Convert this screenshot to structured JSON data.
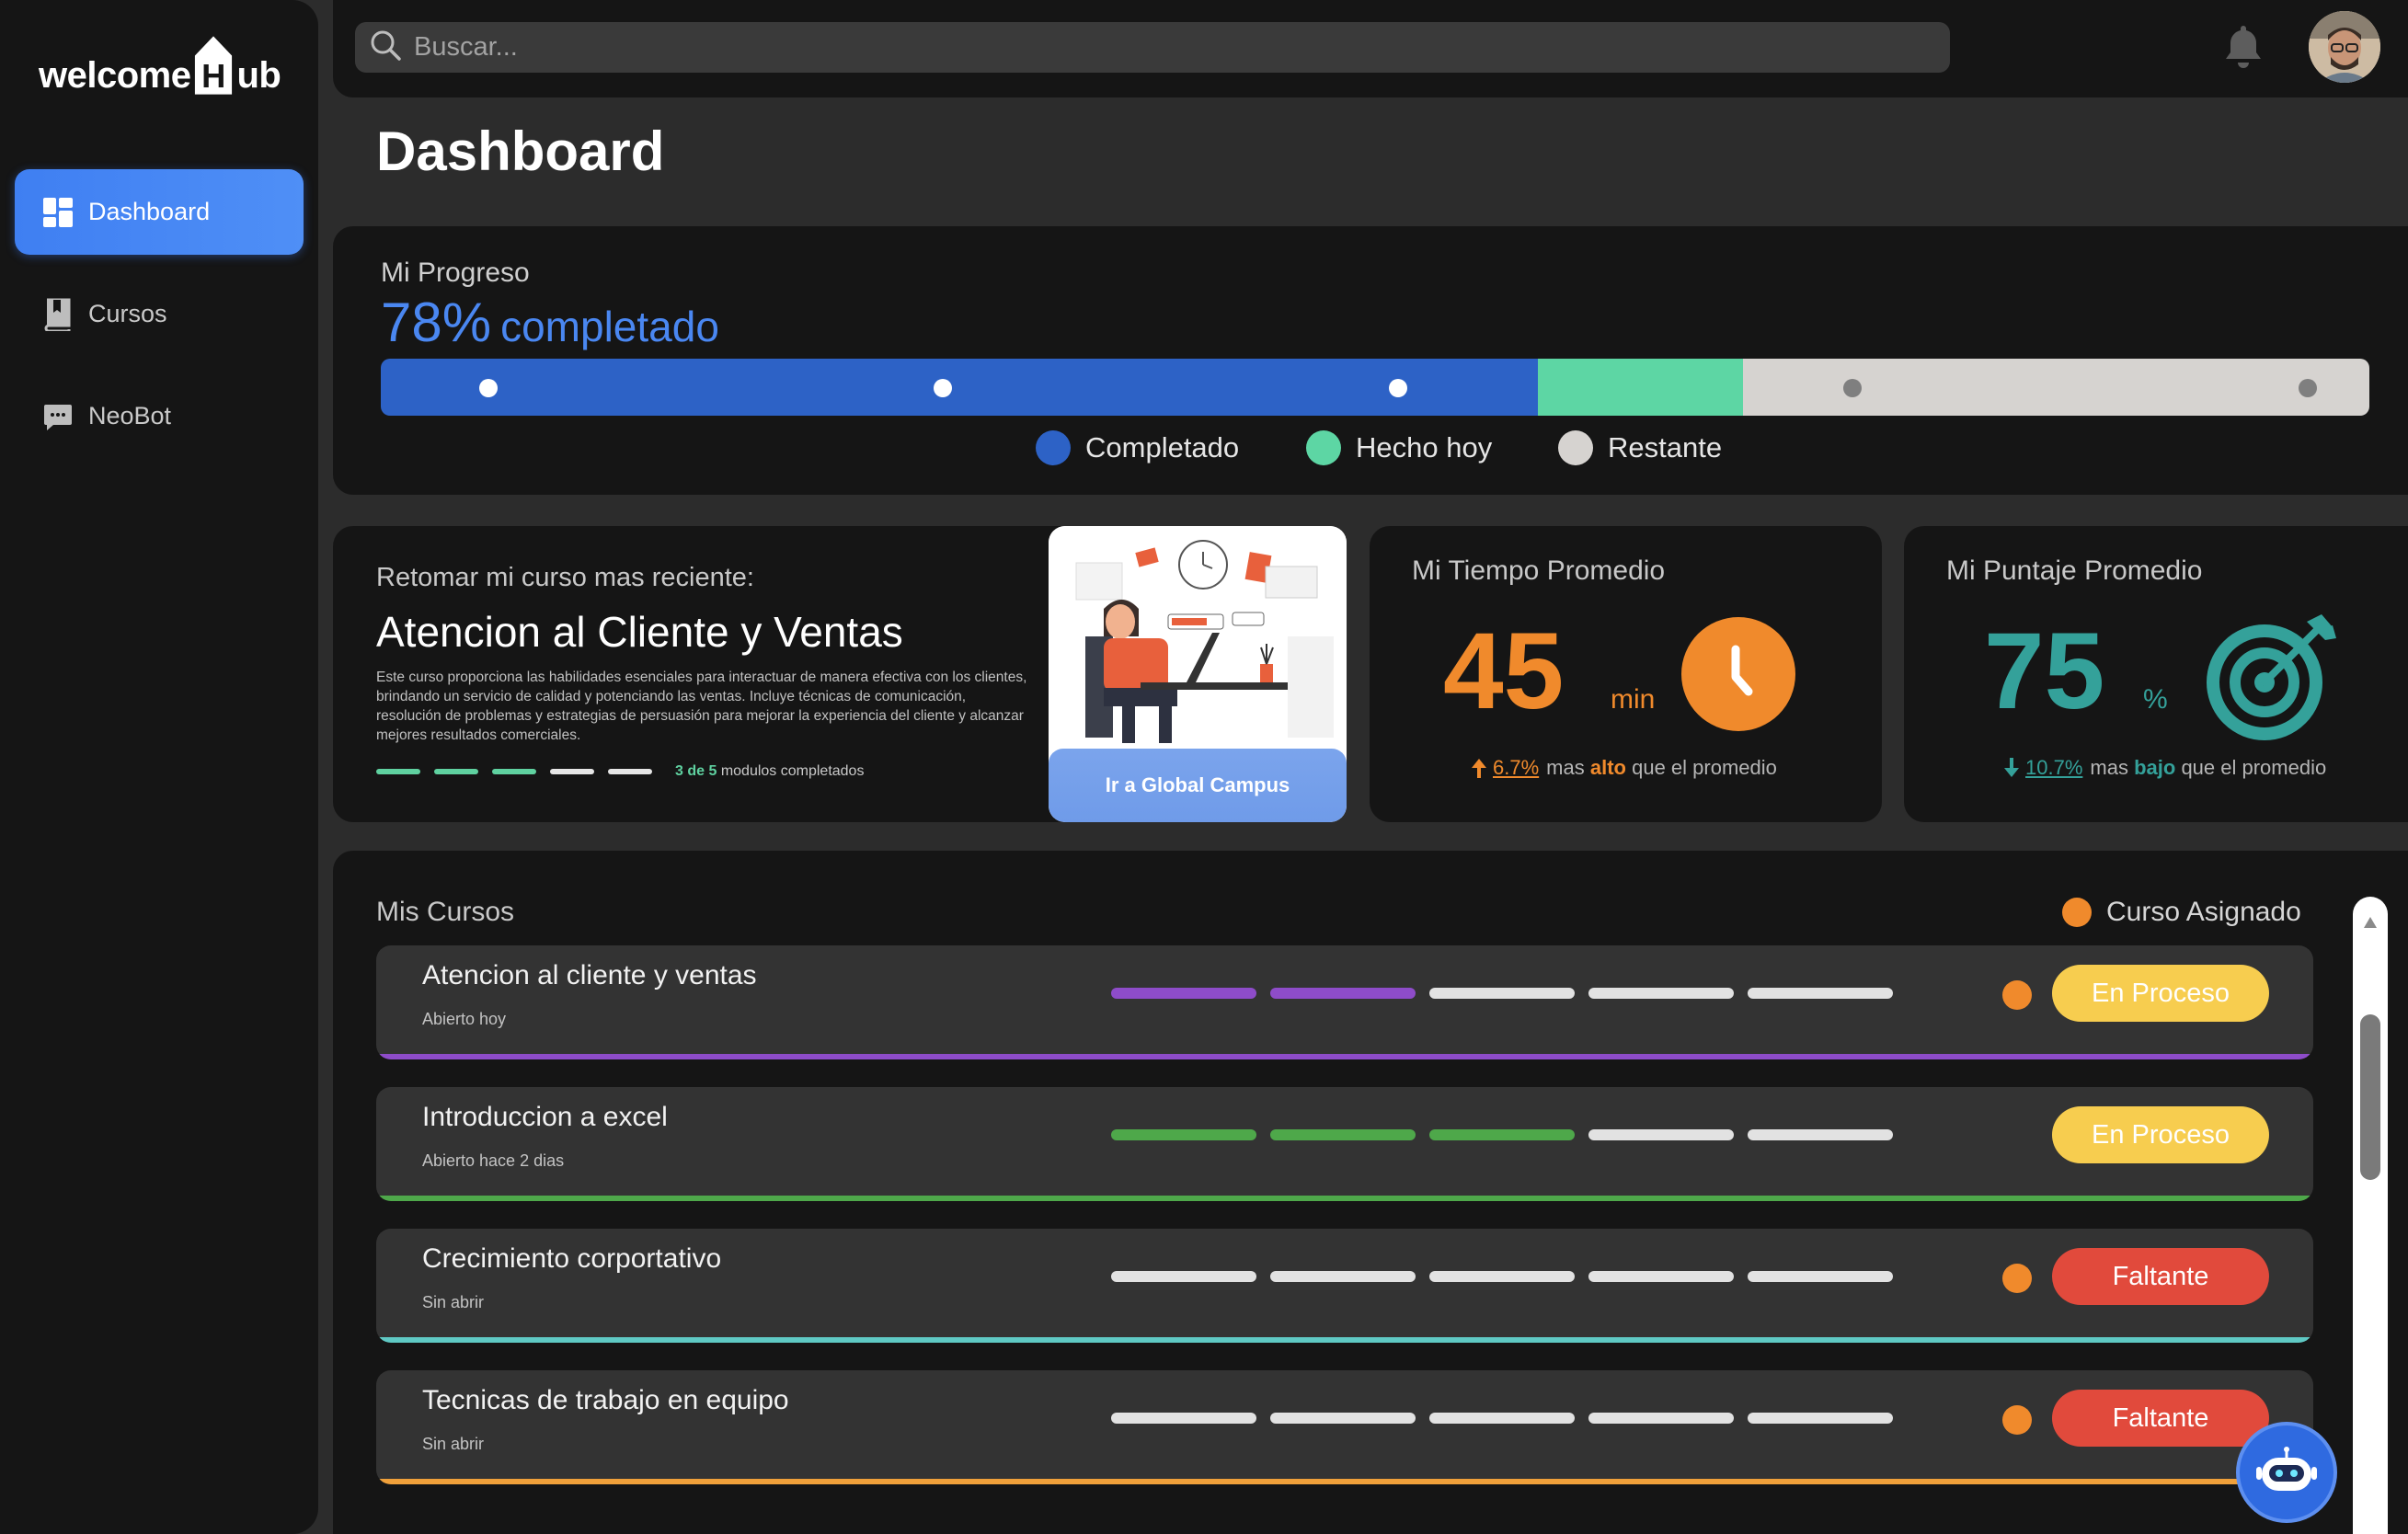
{
  "brand": {
    "text_before": "welcome",
    "text_house": "H",
    "text_after": "ub"
  },
  "sidebar": {
    "items": [
      {
        "label": "Dashboard",
        "icon": "dashboard-grid-icon",
        "active": true
      },
      {
        "label": "Cursos",
        "icon": "book-icon",
        "active": false
      },
      {
        "label": "NeoBot",
        "icon": "chat-bubble-icon",
        "active": false
      }
    ]
  },
  "topbar": {
    "search_placeholder": "Buscar...",
    "icons": [
      "search-icon",
      "bell-icon"
    ],
    "avatar": "user-avatar"
  },
  "page": {
    "title": "Dashboard"
  },
  "progress": {
    "label": "Mi Progreso",
    "percent": "78%",
    "percent_word": "completado",
    "segments": {
      "completado": 0.582,
      "hecho_hoy": 0.103,
      "restante": 0.315
    },
    "legend": [
      {
        "label": "Completado",
        "color": "#2d62c6"
      },
      {
        "label": "Hecho hoy",
        "color": "#5dd6a4"
      },
      {
        "label": "Restante",
        "color": "#d6d3d0"
      }
    ],
    "colors": {
      "completado": "#2d62c6",
      "hecho_hoy": "#5dd6a4",
      "restante": "#d6d3d0"
    }
  },
  "resume": {
    "label": "Retomar mi curso mas reciente:",
    "title": "Atencion al Cliente y Ventas",
    "description": "Este curso proporciona las habilidades esenciales para interactuar de manera efectiva con los clientes, brindando un servicio de calidad y potenciando las ventas. Incluye técnicas de comunicación, resolución de problemas y estrategias de persuasión para mejorar la experiencia del cliente y alcanzar mejores resultados comerciales.",
    "modules_done": 3,
    "modules_total": 5,
    "modules_count": "3 de 5",
    "modules_text": "modulos completados",
    "button_label": "Ir a Global Campus"
  },
  "time_stat": {
    "label": "Mi Tiempo Promedio",
    "value": "45",
    "unit": "min",
    "delta": "6.7%",
    "delta_word": "mas",
    "delta_strong": "alto",
    "delta_tail": "que el promedio",
    "color": "#f08a2c",
    "icon": "clock-icon"
  },
  "score_stat": {
    "label": "Mi Puntaje Promedio",
    "value": "75",
    "unit": "%",
    "delta": "10.7%",
    "delta_word": "mas",
    "delta_strong": "bajo",
    "delta_tail": "que el promedio",
    "color": "#34a19a",
    "icon": "target-icon"
  },
  "courses": {
    "title": "Mis Cursos",
    "legend_label": "Curso Asignado",
    "rows": [
      {
        "name": "Atencion al cliente y ventas",
        "sub": "Abierto hoy",
        "done": 2,
        "total": 5,
        "color": "#8e4cc9",
        "assigned": true,
        "status": "En Proceso",
        "status_color": "#f7cd4f"
      },
      {
        "name": "Introduccion a excel",
        "sub": "Abierto hace 2 dias",
        "done": 3,
        "total": 5,
        "color": "#4ea84a",
        "assigned": false,
        "status": "En Proceso",
        "status_color": "#f7cd4f"
      },
      {
        "name": "Crecimiento corportativo",
        "sub": "Sin abrir",
        "done": 0,
        "total": 5,
        "color": "#5fc9c4",
        "assigned": true,
        "status": "Faltante",
        "status_color": "#e14a3c"
      },
      {
        "name": "Tecnicas de trabajo en equipo",
        "sub": "Sin abrir",
        "done": 0,
        "total": 5,
        "color": "#f0a03a",
        "assigned": true,
        "status": "Faltante",
        "status_color": "#e14a3c"
      }
    ]
  },
  "chatbot": {
    "icon": "robot-icon"
  }
}
